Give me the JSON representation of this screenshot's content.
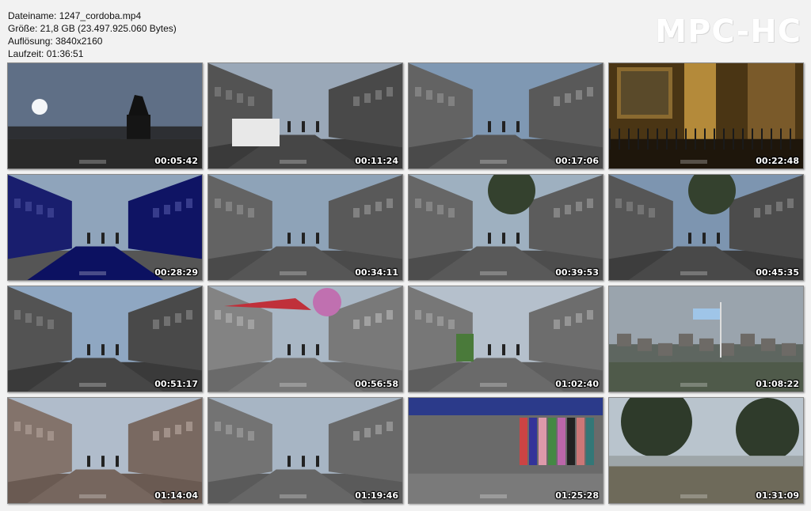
{
  "header": {
    "filename": "Dateiname: 1247_cordoba.mp4",
    "size": "Größe: 21,8 GB (23.497.925.060 Bytes)",
    "resolution": "Auflösung: 3840x2160",
    "duration": "Laufzeit: 01:36:51",
    "brand": "MPC-HC"
  },
  "thumbnails": [
    {
      "time": "00:05:42",
      "scene": "plaza-statue-silhouette",
      "colors": {
        "sky": "#5f6f86",
        "ground": "#2a2a2a"
      }
    },
    {
      "time": "00:11:24",
      "scene": "street-white-van",
      "colors": {
        "sky": "#9aa8b8",
        "ground": "#3a3a3a"
      }
    },
    {
      "time": "00:17:06",
      "scene": "pedestrian-street-glass-building",
      "colors": {
        "sky": "#7f98b3",
        "ground": "#4a4a4a"
      }
    },
    {
      "time": "00:22:48",
      "scene": "cathedral-interior",
      "colors": {
        "sky": "#6b5020",
        "ground": "#2a1e10"
      }
    },
    {
      "time": "00:28:29",
      "scene": "street-cafes-historic-buildings",
      "colors": {
        "sky": "#8fa4bb",
        "ground": "#555"
      }
    },
    {
      "time": "00:34:11",
      "scene": "street-kiosk",
      "colors": {
        "sky": "#8ea3b8",
        "ground": "#4a4a4a"
      }
    },
    {
      "time": "00:39:53",
      "scene": "tree-lined-avenue",
      "colors": {
        "sky": "#9eb0c0",
        "ground": "#4d4d4d"
      }
    },
    {
      "time": "00:45:35",
      "scene": "colonial-buildings-street",
      "colors": {
        "sky": "#7d95b0",
        "ground": "#3d3d3d"
      }
    },
    {
      "time": "00:51:17",
      "scene": "modern-storefront-street",
      "colors": {
        "sky": "#8fa7c2",
        "ground": "#3a3a3a"
      }
    },
    {
      "time": "00:56:58",
      "scene": "street-umbrellas-pedestrians",
      "colors": {
        "sky": "#a9b7c5",
        "ground": "#6a6a6a"
      }
    },
    {
      "time": "01:02:40",
      "scene": "street-green-bins",
      "colors": {
        "sky": "#b5c0cc",
        "ground": "#5e5e5e"
      }
    },
    {
      "time": "01:08:22",
      "scene": "park-flag-skyline",
      "colors": {
        "sky": "#9aa4ad",
        "ground": "#4f5a4a"
      }
    },
    {
      "time": "01:14:04",
      "scene": "sidewalk-pedestrians-backpack",
      "colors": {
        "sky": "#b0bccb",
        "ground": "#6a5a52"
      }
    },
    {
      "time": "01:19:46",
      "scene": "street-signs-pedestrians",
      "colors": {
        "sky": "#a7b5c4",
        "ground": "#5a5a5a"
      }
    },
    {
      "time": "01:25:28",
      "scene": "market-clothes-stalls",
      "colors": {
        "sky": "#3b4a7a",
        "ground": "#5d5d5d"
      }
    },
    {
      "time": "01:31:09",
      "scene": "riverside-park-trees",
      "colors": {
        "sky": "#b9c4cd",
        "ground": "#6e6a5a"
      }
    }
  ]
}
